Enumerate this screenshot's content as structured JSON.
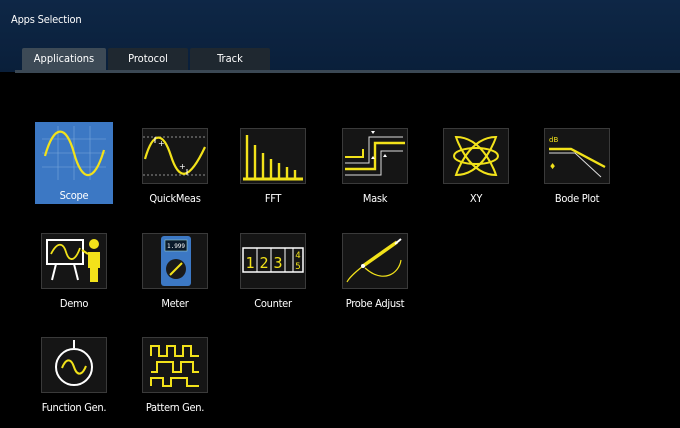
{
  "window": {
    "title": "Apps Selection"
  },
  "tabs": [
    {
      "label": "Applications",
      "active": true
    },
    {
      "label": "Protocol",
      "active": false
    },
    {
      "label": "Track",
      "active": false
    }
  ],
  "apps": [
    {
      "label": "Scope",
      "icon": "scope-icon",
      "selected": true
    },
    {
      "label": "QuickMeas",
      "icon": "quickmeas-icon"
    },
    {
      "label": "FFT",
      "icon": "fft-icon"
    },
    {
      "label": "Mask",
      "icon": "mask-icon"
    },
    {
      "label": "XY",
      "icon": "xy-icon"
    },
    {
      "label": "Bode Plot",
      "icon": "bode-plot-icon",
      "icon_text": "dB"
    },
    {
      "label": "Demo",
      "icon": "demo-icon"
    },
    {
      "label": "Meter",
      "icon": "meter-icon",
      "icon_text": "1.999"
    },
    {
      "label": "Counter",
      "icon": "counter-icon",
      "icon_text": [
        "1",
        "2",
        "3",
        "4",
        "5"
      ]
    },
    {
      "label": "Probe Adjust",
      "icon": "probe-adjust-icon"
    },
    {
      "label": "Function Gen.",
      "icon": "function-gen-icon"
    },
    {
      "label": "Pattern Gen.",
      "icon": "pattern-gen-icon"
    }
  ],
  "colors": {
    "accent": "#3c78c4",
    "icon": "#f2e21a",
    "background": "#000000"
  }
}
